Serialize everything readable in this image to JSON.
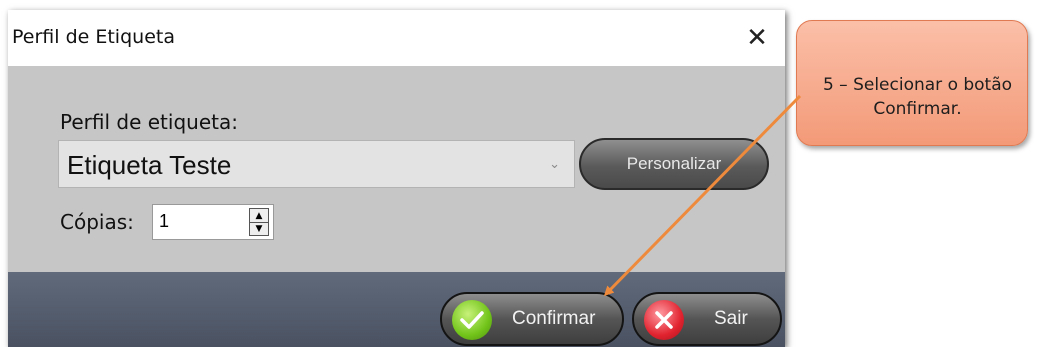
{
  "dialog": {
    "title": "Perfil de Etiqueta",
    "close_glyph": "✕",
    "profile_label": "Perfil de etiqueta:",
    "profile_value": "Etiqueta Teste",
    "personalize_label": "Personalizar",
    "copies_label": "Cópias:",
    "copies_value": "1",
    "confirm_label": "Confirmar",
    "exit_label": "Sair"
  },
  "callout": {
    "text": "5 – Selecionar o botão Confirmar.",
    "color": "#f6a584",
    "arrow_color": "#ee8a3c"
  },
  "icons": [
    "close-icon",
    "chevron-down-icon",
    "spin-up-icon",
    "spin-down-icon",
    "check-icon",
    "x-icon"
  ]
}
